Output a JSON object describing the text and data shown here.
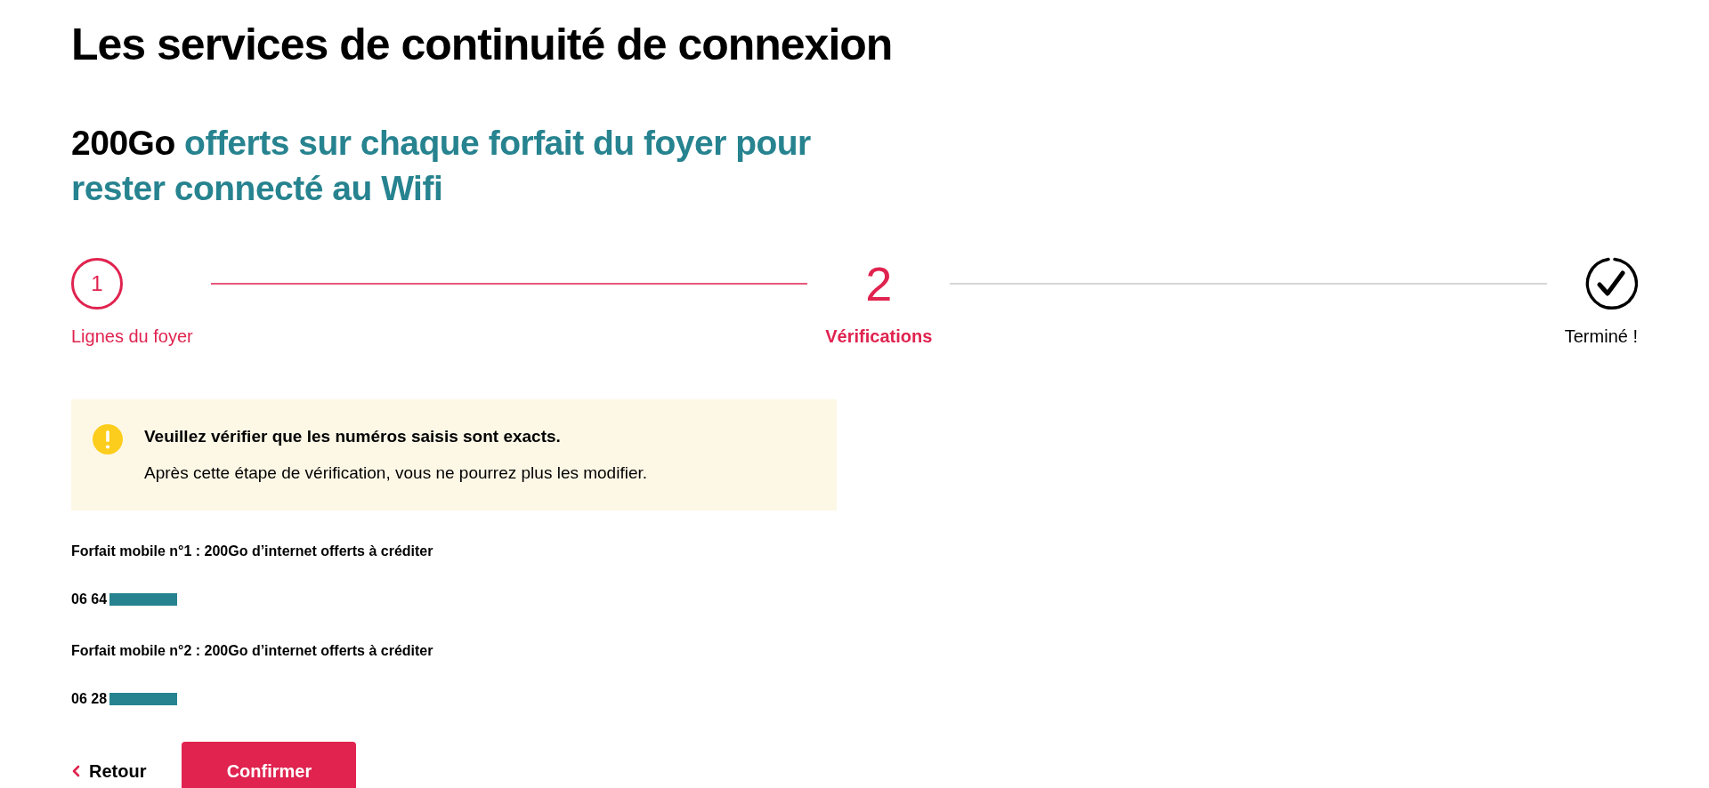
{
  "title": "Les services de continuité de connexion",
  "subtitle": {
    "emphasis": "200Go",
    "text": "offerts sur chaque forfait du foyer pour rester connecté au Wifi"
  },
  "steps": [
    {
      "number": "1",
      "label": "Lignes du foyer",
      "kind": "done"
    },
    {
      "number": "2",
      "label": "Vérifications",
      "kind": "current"
    },
    {
      "label": "Terminé !",
      "kind": "upcoming"
    }
  ],
  "alert": {
    "title": "Veuillez vérifier que les numéros saisis sont exacts.",
    "text": "Après cette étape de vérification, vous ne pourrez plus les modifier."
  },
  "lines": [
    {
      "label": "Forfait mobile n°1 : 200Go d’internet offerts à créditer",
      "number": "06 64"
    },
    {
      "label": "Forfait mobile n°2 : 200Go d’internet offerts à créditer",
      "number": "06 28"
    }
  ],
  "back_link": "Retour",
  "confirm_button": "Confirmer"
}
